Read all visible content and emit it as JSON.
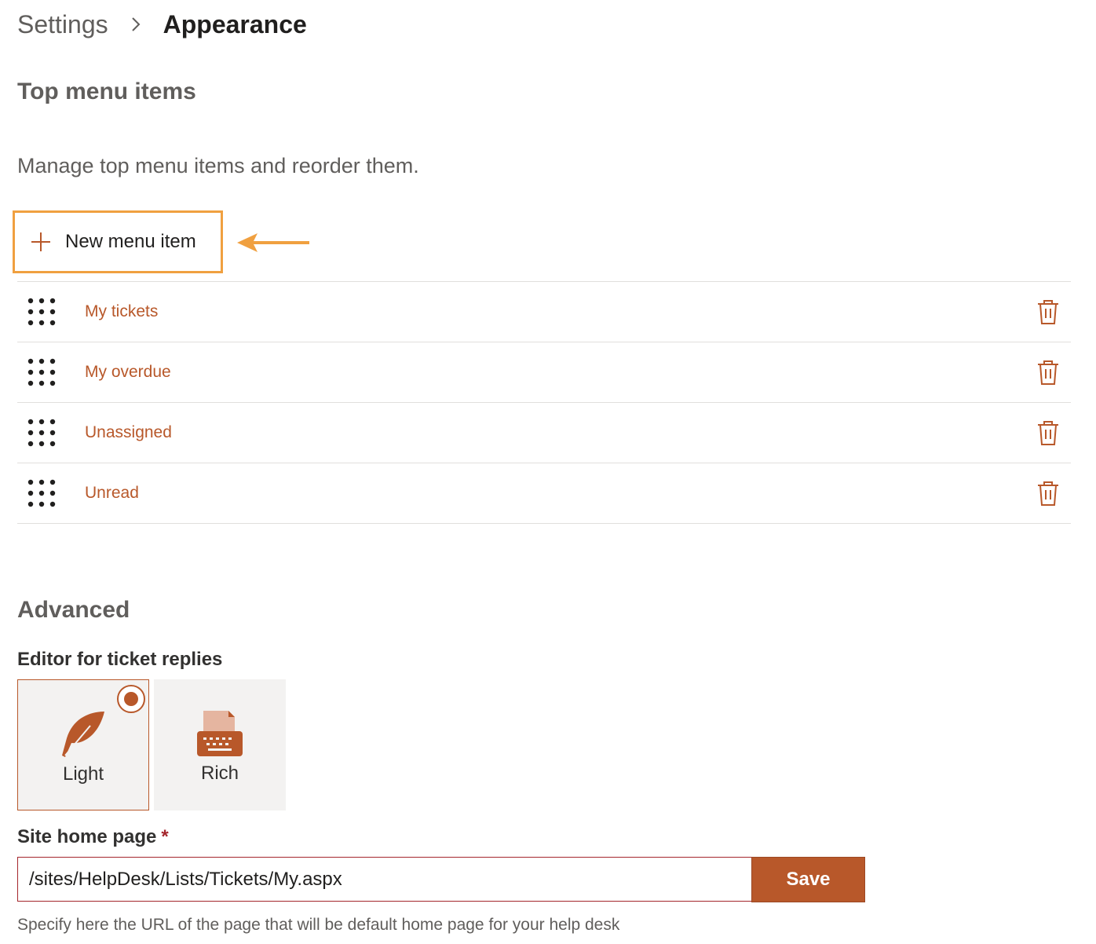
{
  "breadcrumb": {
    "parent": "Settings",
    "current": "Appearance"
  },
  "top_menu": {
    "title": "Top menu items",
    "description": "Manage top menu items and reorder them.",
    "new_item_label": "New menu item",
    "items": [
      {
        "label": "My tickets"
      },
      {
        "label": "My overdue"
      },
      {
        "label": "Unassigned"
      },
      {
        "label": "Unread"
      }
    ]
  },
  "advanced": {
    "title": "Advanced",
    "editor_label": "Editor for ticket replies",
    "editor_options": [
      {
        "label": "Light",
        "icon": "feather-icon",
        "selected": true
      },
      {
        "label": "Rich",
        "icon": "typewriter-icon",
        "selected": false
      }
    ],
    "home_page_label": "Site home page",
    "required_marker": "*",
    "home_page_value": "/sites/HelpDesk/Lists/Tickets/My.aspx",
    "save_label": "Save",
    "hint": "Specify here the URL of the page that will be default home page for your help desk"
  },
  "colors": {
    "accent": "#b8582a",
    "highlight": "#f0a040",
    "text": "#323130",
    "muted": "#605e5c",
    "divider": "#e1dfdd"
  }
}
